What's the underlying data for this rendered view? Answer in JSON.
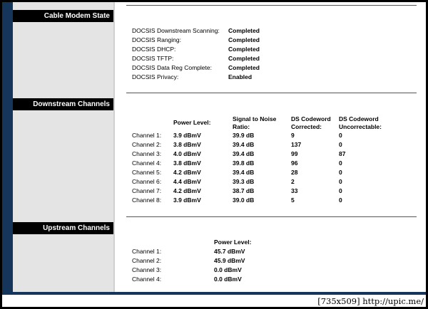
{
  "sections": {
    "cable_modem_state": "Cable Modem State",
    "downstream_channels": "Downstream Channels",
    "upstream_channels": "Upstream Channels"
  },
  "modem_state": [
    {
      "label": "DOCSIS Downstream Scanning:",
      "value": "Completed"
    },
    {
      "label": "DOCSIS Ranging:",
      "value": "Completed"
    },
    {
      "label": "DOCSIS DHCP:",
      "value": "Completed"
    },
    {
      "label": "DOCSIS TFTP:",
      "value": "Completed"
    },
    {
      "label": "DOCSIS Data Reg Complete:",
      "value": "Completed"
    },
    {
      "label": "DOCSIS Privacy:",
      "value": "Enabled"
    }
  ],
  "downstream": {
    "headers": {
      "power": "Power Level:",
      "snr_line1": "Signal to Noise",
      "snr_line2": "Ratio:",
      "corr_line1": "DS Codeword",
      "corr_line2": "Corrected:",
      "uncorr_line1": "DS Codeword",
      "uncorr_line2": "Uncorrectable:"
    },
    "rows": [
      {
        "channel": "Channel 1:",
        "power": "3.9 dBmV",
        "snr": "39.9 dB",
        "corrected": "9",
        "uncorrectable": "0"
      },
      {
        "channel": "Channel 2:",
        "power": "3.8 dBmV",
        "snr": "39.4 dB",
        "corrected": "137",
        "uncorrectable": "0"
      },
      {
        "channel": "Channel 3:",
        "power": "4.0 dBmV",
        "snr": "39.4 dB",
        "corrected": "99",
        "uncorrectable": "87"
      },
      {
        "channel": "Channel 4:",
        "power": "3.8 dBmV",
        "snr": "39.8 dB",
        "corrected": "96",
        "uncorrectable": "0"
      },
      {
        "channel": "Channel 5:",
        "power": "4.2 dBmV",
        "snr": "39.4 dB",
        "corrected": "28",
        "uncorrectable": "0"
      },
      {
        "channel": "Channel 6:",
        "power": "4.4 dBmV",
        "snr": "39.3 dB",
        "corrected": "2",
        "uncorrectable": "0"
      },
      {
        "channel": "Channel 7:",
        "power": "4.2 dBmV",
        "snr": "38.7 dB",
        "corrected": "33",
        "uncorrectable": "0"
      },
      {
        "channel": "Channel 8:",
        "power": "3.9 dBmV",
        "snr": "39.0 dB",
        "corrected": "5",
        "uncorrectable": "0"
      }
    ]
  },
  "upstream": {
    "headers": {
      "power": "Power Level:"
    },
    "rows": [
      {
        "channel": "Channel 1:",
        "power": "45.7 dBmV"
      },
      {
        "channel": "Channel 2:",
        "power": "45.9 dBmV"
      },
      {
        "channel": "Channel 3:",
        "power": "0.0 dBmV"
      },
      {
        "channel": "Channel 4:",
        "power": "0.0 dBmV"
      }
    ]
  },
  "watermark": "[735x509] http://upic.me/",
  "colors": {
    "sidebar_blue": "#16355a",
    "label_black": "#000000",
    "panel_gray": "#e4e4e4"
  }
}
